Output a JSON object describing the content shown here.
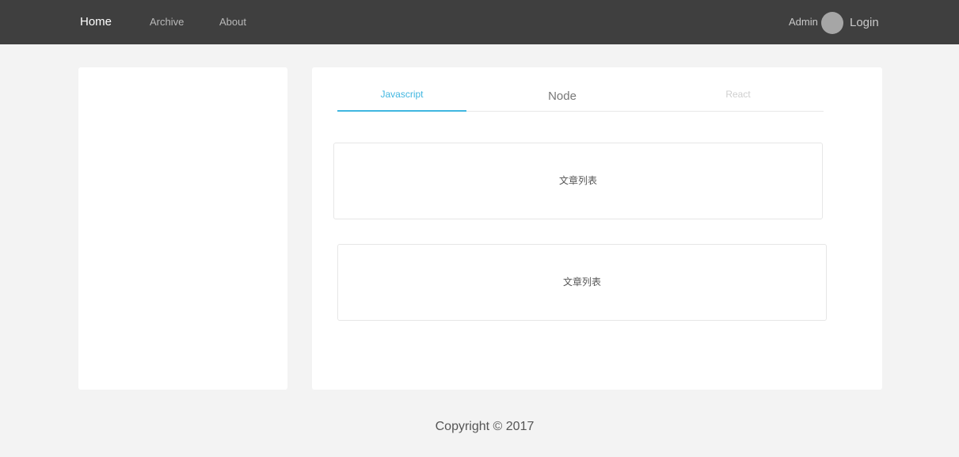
{
  "nav": {
    "items": [
      {
        "label": "Home"
      },
      {
        "label": "Archive"
      },
      {
        "label": "About"
      }
    ],
    "admin_label": "Admin",
    "login_label": "Login"
  },
  "tabs": [
    {
      "label": "Javascript",
      "active": true
    },
    {
      "label": "Node",
      "active": false
    },
    {
      "label": "React",
      "active": false
    }
  ],
  "articles": [
    {
      "label": "文章列表"
    },
    {
      "label": "文章列表"
    }
  ],
  "footer": {
    "copyright": "Copyright © 2017"
  },
  "colors": {
    "topbar_bg": "#3f3f3f",
    "page_bg": "#f3f3f3",
    "accent": "#3fb6e0"
  }
}
